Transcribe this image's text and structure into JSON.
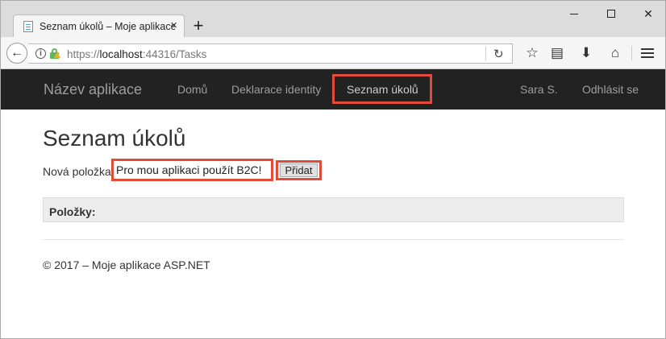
{
  "browser": {
    "tab_title": "Seznam úkolů – Moje aplikace ASP.NET",
    "tab_close": "×",
    "new_tab": "+",
    "url_scheme": "https://",
    "url_host": "localhost",
    "url_rest": ":44316/Tasks",
    "icons": [
      "page-icon",
      "close-icon",
      "plus-icon",
      "minimize-icon",
      "maximize-icon",
      "window-close-icon",
      "back-arrow-icon",
      "info-icon",
      "lock-warning-icon",
      "reload-icon",
      "star-icon",
      "reader-icon",
      "download-icon",
      "home-icon",
      "hamburger-menu-icon"
    ]
  },
  "navbar": {
    "brand": "Název aplikace",
    "links": [
      "Domů",
      "Deklarace identity",
      "Seznam úkolů"
    ],
    "user": "Sara S.",
    "signout": "Odhlásit se"
  },
  "main": {
    "title": "Seznam úkolů",
    "new_item_label": "Nová položka:",
    "new_item_value": "Pro mou aplikaci použít B2C!",
    "add_button": "Přidat",
    "items_header": "Položky:"
  },
  "footer": {
    "text": "© 2017 – Moje aplikace ASP.NET"
  },
  "colors": {
    "navbar_bg": "#222222",
    "highlight": "#e24b39",
    "items_bg": "#ececec"
  }
}
